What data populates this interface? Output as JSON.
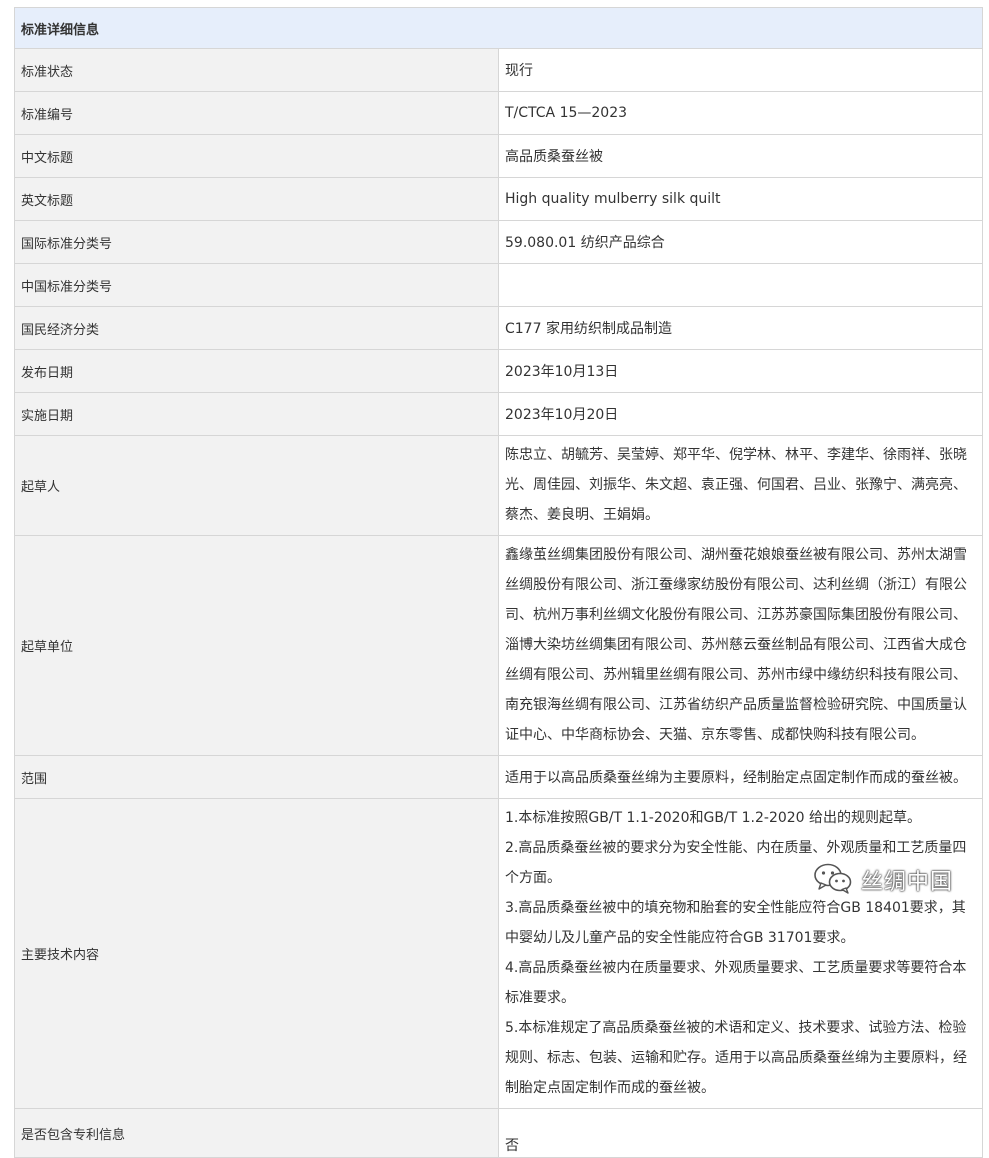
{
  "section_title": "标准详细信息",
  "rows": [
    {
      "label": "标准状态",
      "value": "现行"
    },
    {
      "label": "标准编号",
      "value": "T/CTCA 15—2023"
    },
    {
      "label": "中文标题",
      "value": "高品质桑蚕丝被"
    },
    {
      "label": "英文标题",
      "value": "High quality mulberry silk quilt"
    },
    {
      "label": "国际标准分类号",
      "value": "59.080.01 纺织产品综合"
    },
    {
      "label": "中国标准分类号",
      "value": ""
    },
    {
      "label": "国民经济分类",
      "value": "C177 家用纺织制成品制造"
    },
    {
      "label": "发布日期",
      "value": "2023年10月13日"
    },
    {
      "label": "实施日期",
      "value": "2023年10月20日"
    },
    {
      "label": "起草人",
      "value": "陈忠立、胡毓芳、吴莹婷、郑平华、倪学林、林平、李建华、徐雨祥、张晓光、周佳园、刘振华、朱文超、袁正强、何国君、吕业、张豫宁、满亮亮、蔡杰、姜良明、王娟娟。"
    },
    {
      "label": "起草单位",
      "value": "鑫缘茧丝绸集团股份有限公司、湖州蚕花娘娘蚕丝被有限公司、苏州太湖雪丝绸股份有限公司、浙江蚕缘家纺股份有限公司、达利丝绸（浙江）有限公司、杭州万事利丝绸文化股份有限公司、江苏苏豪国际集团股份有限公司、淄博大染坊丝绸集团有限公司、苏州慈云蚕丝制品有限公司、江西省大成仓丝绸有限公司、苏州辑里丝绸有限公司、苏州市绿中缘纺织科技有限公司、南充银海丝绸有限公司、江苏省纺织产品质量监督检验研究院、中国质量认证中心、中华商标协会、天猫、京东零售、成都快购科技有限公司。"
    },
    {
      "label": "范围",
      "value": "适用于以高品质桑蚕丝绵为主要原料，经制胎定点固定制作而成的蚕丝被。"
    },
    {
      "label": "主要技术内容",
      "items": [
        "1.本标准按照GB/T 1.1-2020和GB/T 1.2-2020 给出的规则起草。",
        "2.高品质桑蚕丝被的要求分为安全性能、内在质量、外观质量和工艺质量四个方面。",
        "3.高品质桑蚕丝被中的填充物和胎套的安全性能应符合GB 18401要求，其中婴幼儿及儿童产品的安全性能应符合GB 31701要求。",
        "4.高品质桑蚕丝被内在质量要求、外观质量要求、工艺质量要求等要符合本标准要求。",
        "5.本标准规定了高品质桑蚕丝被的术语和定义、技术要求、试验方法、检验规则、标志、包装、运输和贮存。适用于以高品质桑蚕丝绵为主要原料，经制胎定点固定制作而成的蚕丝被。"
      ]
    },
    {
      "label": "是否包含专利信息",
      "value": "否"
    }
  ],
  "watermark": {
    "text": "丝绸中国",
    "icon": "wechat-icon"
  }
}
